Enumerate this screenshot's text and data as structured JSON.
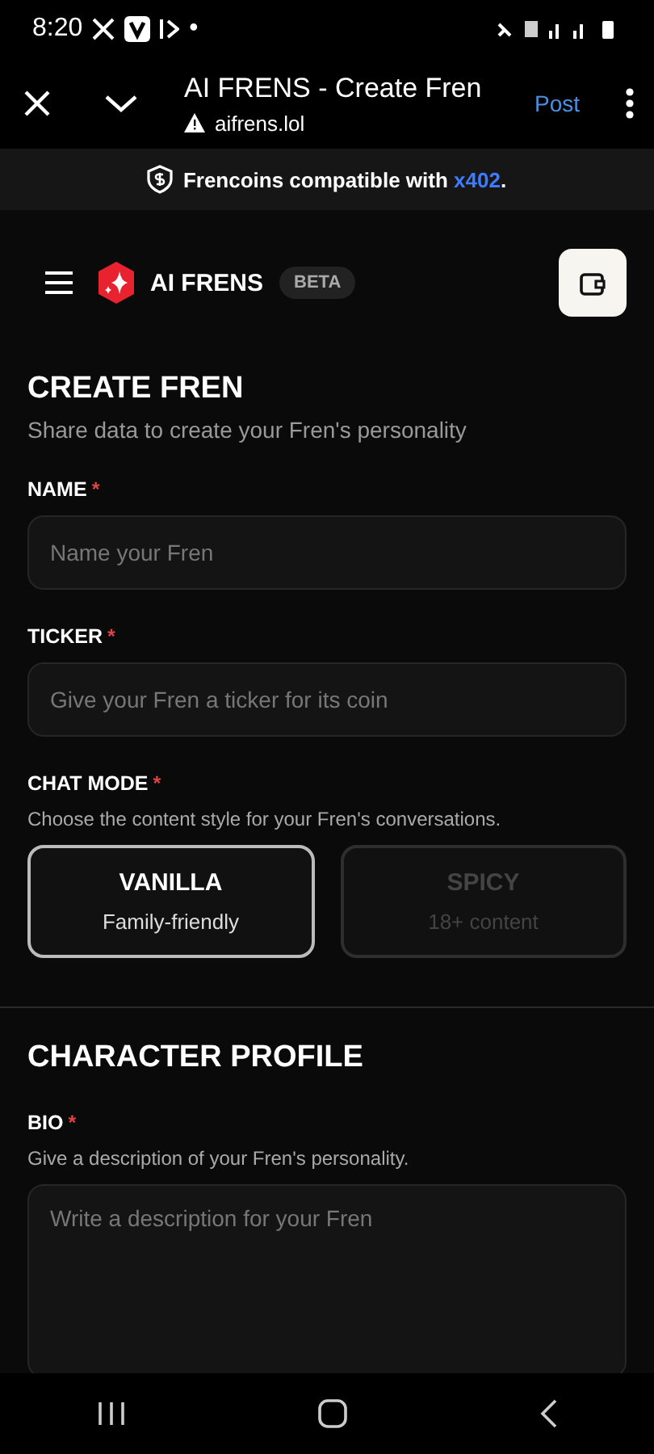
{
  "status_bar": {
    "time": "8:20",
    "dot": "•"
  },
  "browser": {
    "title": "AI FRENS - Create Fren",
    "url": "aifrens.lol",
    "action": "Post"
  },
  "banner": {
    "text": "Frencoins compatible with ",
    "link": "x402",
    "suffix": "."
  },
  "header": {
    "brand": "AI FRENS",
    "badge": "BETA"
  },
  "sections": [
    {
      "title": "CREATE FREN",
      "subtitle": "Share data to create your Fren's personality",
      "fields": [
        {
          "kind": "input",
          "label": "NAME",
          "mark": "*",
          "placeholder": "Name your Fren"
        },
        {
          "kind": "input",
          "label": "TICKER",
          "mark": "*",
          "placeholder": "Give your Fren a ticker for its coin"
        },
        {
          "kind": "choice",
          "label": "CHAT MODE",
          "mark": "*",
          "hint": "Choose the content style for your Fren's conversations.",
          "options": [
            {
              "title": "VANILLA",
              "subtitle": "Family-friendly",
              "selected": true
            },
            {
              "title": "SPICY",
              "subtitle": "18+ content",
              "selected": false
            }
          ]
        }
      ]
    },
    {
      "title": "CHARACTER PROFILE",
      "fields": [
        {
          "kind": "textarea",
          "label": "BIO",
          "mark": "*",
          "hint": "Give a description of your Fren's personality.",
          "placeholder": "Write a description for your Fren"
        }
      ]
    }
  ]
}
